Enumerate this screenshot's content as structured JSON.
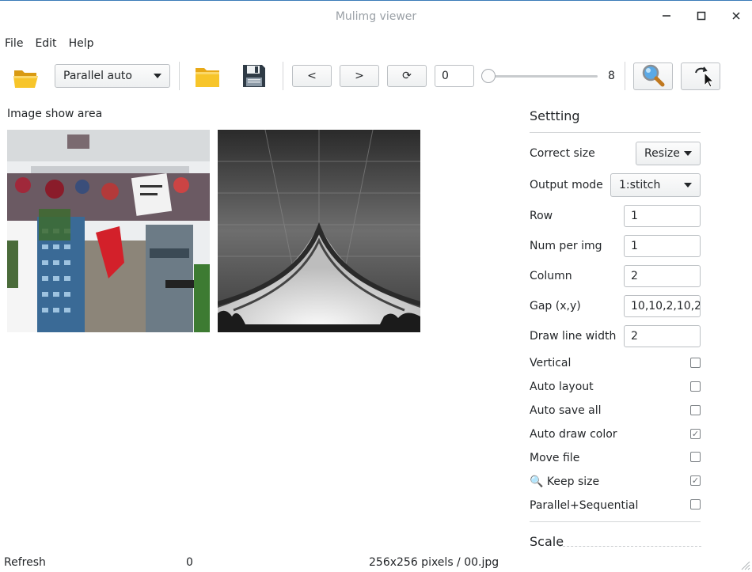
{
  "window": {
    "title": "Mulimg viewer",
    "controls": {
      "minimize": "–",
      "maximize": "□",
      "close": "✕"
    }
  },
  "menu": [
    "File",
    "Edit",
    "Help"
  ],
  "toolbar": {
    "layout_mode": "Parallel auto",
    "prev_label": "<",
    "next_label": ">",
    "refresh_symbol": "⟳",
    "index_value": "0",
    "slider_max": "8",
    "slider_value": 0,
    "icons": [
      "open-folder-icon",
      "folder-icon",
      "save-icon",
      "magnifier-icon",
      "rotate-icon"
    ]
  },
  "image_area": {
    "label": "Image show area",
    "images": [
      "city-street-upside-down",
      "concrete-bridge-underside"
    ]
  },
  "settings": {
    "title": "Settting",
    "correct_size": {
      "label": "Correct size",
      "value": "Resize"
    },
    "output_mode": {
      "label": "Output mode",
      "value": "1:stitch"
    },
    "row": {
      "label": "Row",
      "value": "1"
    },
    "num_per_img": {
      "label": "Num per img",
      "value": "1"
    },
    "column": {
      "label": "Column",
      "value": "2"
    },
    "gap": {
      "label": "Gap (x,y)",
      "value": "10,10,2,10,2"
    },
    "draw_line_width": {
      "label": "Draw line width",
      "value": "2"
    },
    "checks": [
      {
        "label": "Vertical",
        "checked": false
      },
      {
        "label": "Auto layout",
        "checked": false
      },
      {
        "label": "Auto save all",
        "checked": false
      },
      {
        "label": "Auto draw color",
        "checked": true
      },
      {
        "label": "Move file",
        "checked": false
      },
      {
        "label": "Keep size",
        "checked": true
      },
      {
        "label": "Parallel+Sequential",
        "checked": false
      }
    ],
    "keep_size_prefix": "🔍",
    "scale_title": "Scale"
  },
  "status": {
    "left": "Refresh",
    "index": "0",
    "info": "256x256 pixels / 00.jpg"
  },
  "colors": {
    "folder_yellow": "#f7c52a",
    "save_blue": "#2c3e50",
    "accent": "#3a7bb8"
  }
}
